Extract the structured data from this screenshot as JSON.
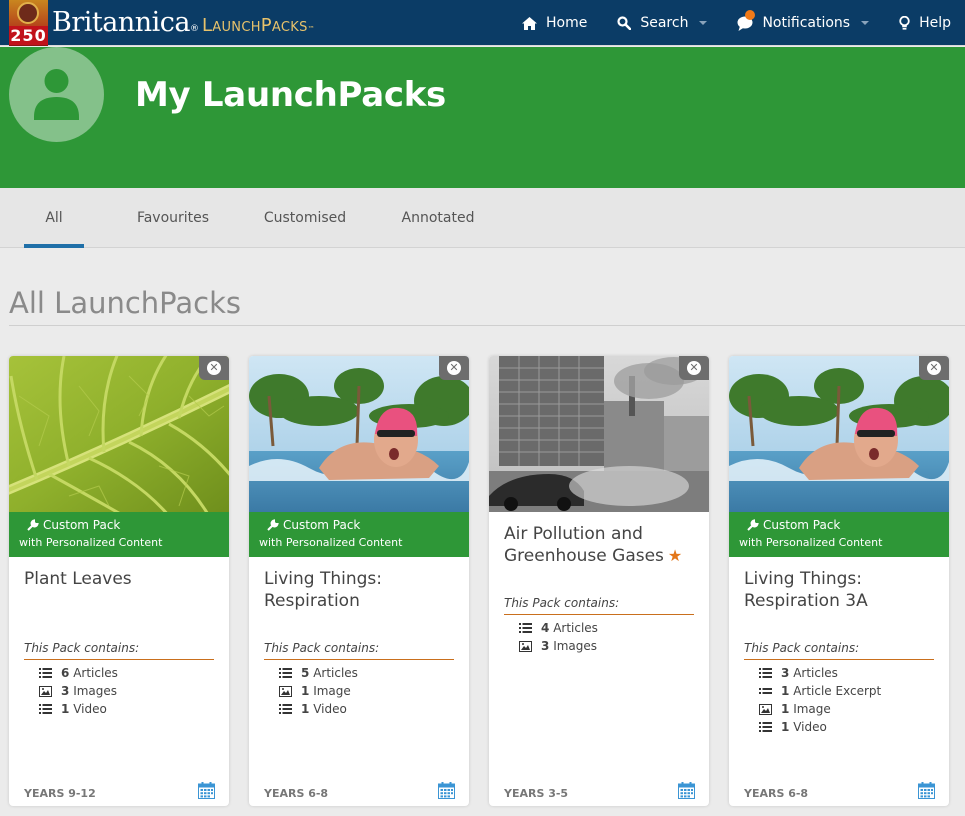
{
  "header": {
    "logo_badge_text": "250",
    "brand": "Britannica",
    "brand_reg": "®",
    "product": "LaunchPacks",
    "product_tm": "™",
    "nav": [
      {
        "label": "Home",
        "icon": "home-icon"
      },
      {
        "label": "Search",
        "icon": "search-icon",
        "dropdown": true
      },
      {
        "label": "Notifications",
        "icon": "chat-bubble-icon",
        "dropdown": true,
        "has_alert": true
      },
      {
        "label": "Help",
        "icon": "lightbulb-icon"
      }
    ]
  },
  "banner": {
    "title": "My LaunchPacks",
    "avatar_icon": "user-avatar-icon"
  },
  "tabs": [
    {
      "label": "All",
      "active": true
    },
    {
      "label": "Favourites",
      "active": false
    },
    {
      "label": "Customised",
      "active": false
    },
    {
      "label": "Annotated",
      "active": false
    }
  ],
  "section": {
    "title": "All LaunchPacks"
  },
  "cards": [
    {
      "title": "Plant Leaves",
      "custom": true,
      "ribbon_line1": "Custom Pack",
      "ribbon_line2": "with Personalized Content",
      "contains_label": "This Pack contains:",
      "items": [
        {
          "icon": "list-icon",
          "count": "6",
          "label": "Articles"
        },
        {
          "icon": "image-icon",
          "count": "3",
          "label": "Images"
        },
        {
          "icon": "list-icon",
          "count": "1",
          "label": "Video"
        }
      ],
      "years": "YEARS 9-12",
      "thumb": "leaf"
    },
    {
      "title": "Living Things: Respiration",
      "custom": true,
      "ribbon_line1": "Custom Pack",
      "ribbon_line2": "with Personalized Content",
      "contains_label": "This Pack contains:",
      "items": [
        {
          "icon": "list-icon",
          "count": "5",
          "label": "Articles"
        },
        {
          "icon": "image-icon",
          "count": "1",
          "label": "Image"
        },
        {
          "icon": "list-icon",
          "count": "1",
          "label": "Video"
        }
      ],
      "years": "YEARS 6-8",
      "thumb": "swimmer"
    },
    {
      "title": "Air Pollution and Greenhouse Gases",
      "custom": false,
      "favourite": true,
      "contains_label": "This Pack contains:",
      "items": [
        {
          "icon": "list-icon",
          "count": "4",
          "label": "Articles"
        },
        {
          "icon": "image-icon",
          "count": "3",
          "label": "Images"
        }
      ],
      "years": "YEARS 3-5",
      "thumb": "city"
    },
    {
      "title": "Living Things: Respiration 3A",
      "custom": true,
      "ribbon_line1": "Custom Pack",
      "ribbon_line2": "with Personalized Content",
      "contains_label": "This Pack contains:",
      "items": [
        {
          "icon": "list-icon",
          "count": "3",
          "label": "Articles"
        },
        {
          "icon": "excerpt-icon",
          "count": "1",
          "label": "Article Excerpt"
        },
        {
          "icon": "image-icon",
          "count": "1",
          "label": "Image"
        },
        {
          "icon": "list-icon",
          "count": "1",
          "label": "Video"
        }
      ],
      "years": "YEARS 6-8",
      "thumb": "swimmer"
    }
  ],
  "colors": {
    "navbar": "#0b3c66",
    "banner_green": "#2e9737",
    "tab_underline": "#1f6fa8",
    "accent_orange": "#c96f1d",
    "calendar_blue": "#3b95d4"
  }
}
